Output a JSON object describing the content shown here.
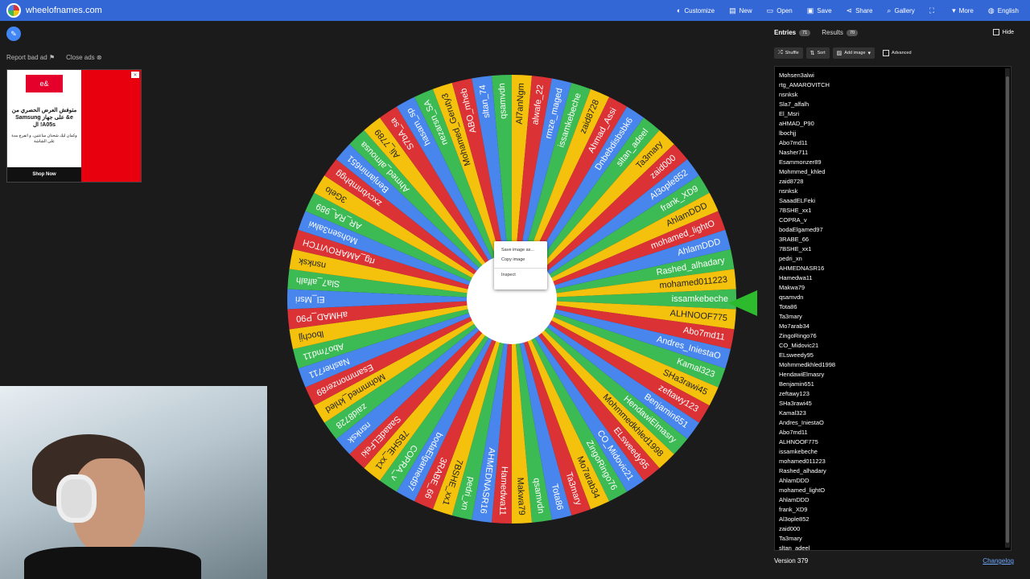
{
  "site": {
    "name": "wheelofnames.com"
  },
  "nav": [
    {
      "icon": "palette-icon",
      "glyph": "◐",
      "label": "Customize"
    },
    {
      "icon": "new-file-icon",
      "glyph": "▤",
      "label": "New"
    },
    {
      "icon": "folder-icon",
      "glyph": "▭",
      "label": "Open"
    },
    {
      "icon": "save-icon",
      "glyph": "▣",
      "label": "Save"
    },
    {
      "icon": "share-icon",
      "glyph": "⋖",
      "label": "Share"
    },
    {
      "icon": "search-icon",
      "glyph": "⌕",
      "label": "Gallery"
    },
    {
      "icon": "fullscreen-icon",
      "glyph": "⛶",
      "label": ""
    },
    {
      "icon": "chevron-down-icon",
      "glyph": "▾",
      "label": "More"
    },
    {
      "icon": "globe-icon",
      "glyph": "◍",
      "label": "English"
    }
  ],
  "ad": {
    "report_label": "Report bad ad",
    "close_label": "Close ads",
    "brand": "e&",
    "headline": "متوفش العرض الحصري من e& على جهاز Samsung A05s! ال",
    "subtext": "وكمان ليك شحنان ساعتين، و اتفرج مدة على الشاشة",
    "cta": "Shop Now"
  },
  "context_menu": {
    "items": [
      "Save image as...",
      "Copy image",
      "Inspect"
    ]
  },
  "panel": {
    "tabs": [
      {
        "label": "Entries",
        "count": "71",
        "active": true
      },
      {
        "label": "Results",
        "count": "70",
        "active": false
      }
    ],
    "hide_label": "Hide",
    "toolbar": {
      "shuffle": "Shuffle",
      "sort": "Sort",
      "add_image": "Add image",
      "advanced": "Advanced"
    },
    "entries": [
      "Mohsen3alwi",
      "rtg_AMAROVITCH",
      "nsnksk",
      "Sla7_alfalh",
      "El_Msri",
      "aHMAD_P90",
      "lbochjj",
      "Abo7md11",
      "Nasher711",
      "Esammonzer89",
      "Mohmmed_khled",
      "zaid8728",
      "nsnksk",
      "SaaadELFeki",
      "7BSHE_xx1",
      "COPRA_v",
      "bodaElgamed97",
      "3RABE_66",
      "7BSHE_xx1",
      "pedri_xn",
      "AHMEDNASR16",
      "Hamedwa11",
      "Makwa79",
      "qsamvdn",
      "Tota86",
      "Ta3mary",
      "Mo7arab34",
      "ZingoRingo76",
      "CO_Midovic21",
      "ELsweedy95",
      "Mohmmedkhled1998",
      "HendawiElmasry",
      "Benjamin651",
      "zeftawy123",
      "SHa3rawi45",
      "Kamal323",
      "Andres_IniestaO",
      "Abo7md11",
      "ALHNOOF775",
      "issamkebeche",
      "mohamed011223",
      "Rashed_alhadary",
      "AhlamDDD",
      "mohamed_lightO",
      "AhlamDDD",
      "frank_XD9",
      "Al3ople852",
      "zaid000",
      "Ta3mary",
      "sltan_adeel"
    ],
    "version": "Version 379",
    "changelog": "Changelog"
  },
  "wheel": {
    "colors": [
      "#3cba54",
      "#f4c20d",
      "#db3236",
      "#4885ed"
    ],
    "labels": [
      "issamkebeche",
      "ALHNOOF775",
      "Abo7md11",
      "Andres_IniestaO",
      "Kamal323",
      "SHa3rawi45",
      "zeftawy123",
      "Benjamin651",
      "HendawiElmasry",
      "Mohmmedkhled1998",
      "ELsweedy95",
      "CO_Midovic21",
      "ZingoRingo76",
      "Mo7arab34",
      "Ta3mary",
      "Tota86",
      "qsamvdn",
      "Makwa79",
      "Hamedwa11",
      "AHMEDNASR16",
      "pedri_xn",
      "7BSHE_xx1",
      "3RABE_66",
      "bodaElgamed97",
      "COPRA_v",
      "7BSHE_xx1",
      "SaaadELFeki",
      "nsnksk",
      "zaid8728",
      "Mohmmed_khled",
      "Esammonzer89",
      "Nasher711",
      "Abo7md11",
      "lbochjj",
      "aHMAD_P90",
      "El_Msri",
      "Sla7_alfalh",
      "nsnksk",
      "rtg_AMAROVITCH",
      "Mohsen3alwi",
      "AR_RA_989",
      "3Gelo",
      "zxcvbnmbhgg",
      "Benjamin651",
      "Ahmed_almousa",
      "Ali_7789",
      "S7bA_sa",
      "hasam_sp",
      "nezarsn_SA",
      "Mohamed_Geruty3",
      "ABO_mheb",
      "sltan_74",
      "qsamvdn",
      "Al7anNgm",
      "alwafe_22",
      "rmze_maged",
      "issamkebeche",
      "zaid8728",
      "Ahmad_Assi",
      "Dnbebdisbsbk6",
      "sltan_adeel",
      "Ta3mary",
      "zaid000",
      "Al3ople852",
      "frank_XD9",
      "AhlamDDD",
      "mohamed_lightO",
      "AhlamDDD",
      "Rashed_alhadary",
      "mohamed011223"
    ]
  }
}
